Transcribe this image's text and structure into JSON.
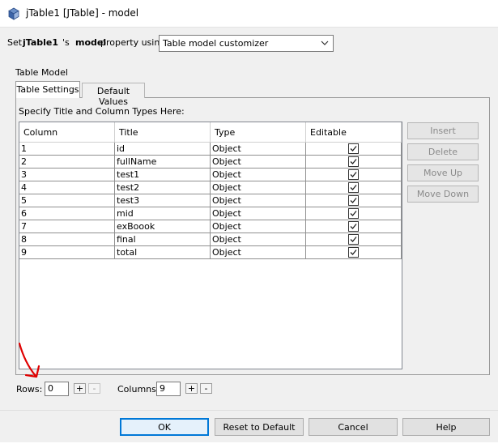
{
  "window": {
    "title": "jTable1 [JTable] - model",
    "icon": "java-bean-icon"
  },
  "property_row": {
    "prefix": "Set ",
    "component": "jTable1",
    "possessive": "'s ",
    "property": "model",
    "suffix": " property using:",
    "select_value": "Table model customizer"
  },
  "table_model_label": "Table Model",
  "tabs": [
    {
      "label": "Table Settings",
      "active": true
    },
    {
      "label": "Default Values",
      "active": false
    }
  ],
  "spec_label": "Specify Title and Column Types Here:",
  "table": {
    "headers": [
      "Column",
      "Title",
      "Type",
      "Editable"
    ],
    "rows": [
      {
        "column": "1",
        "title": "id",
        "type": "Object",
        "editable": true
      },
      {
        "column": "2",
        "title": "fullName",
        "type": "Object",
        "editable": true
      },
      {
        "column": "3",
        "title": "test1",
        "type": "Object",
        "editable": true
      },
      {
        "column": "4",
        "title": "test2",
        "type": "Object",
        "editable": true
      },
      {
        "column": "5",
        "title": "test3",
        "type": "Object",
        "editable": true
      },
      {
        "column": "6",
        "title": "mid",
        "type": "Object",
        "editable": true
      },
      {
        "column": "7",
        "title": "exBoook",
        "type": "Object",
        "editable": true
      },
      {
        "column": "8",
        "title": "final",
        "type": "Object",
        "editable": true
      },
      {
        "column": "9",
        "title": "total",
        "type": "Object",
        "editable": true
      }
    ]
  },
  "side_buttons": [
    "Insert",
    "Delete",
    "Move Up",
    "Move Down"
  ],
  "rows_control": {
    "label": "Rows:",
    "value": "0",
    "plus": "+",
    "minus": "-"
  },
  "columns_control": {
    "label": "Columns:",
    "value": "9",
    "plus": "+",
    "minus": "-"
  },
  "dialog_buttons": {
    "ok": "OK",
    "reset": "Reset to Default",
    "cancel": "Cancel",
    "help": "Help"
  },
  "colors": {
    "accent": "#0078d7",
    "annotation_red": "#e00000"
  }
}
